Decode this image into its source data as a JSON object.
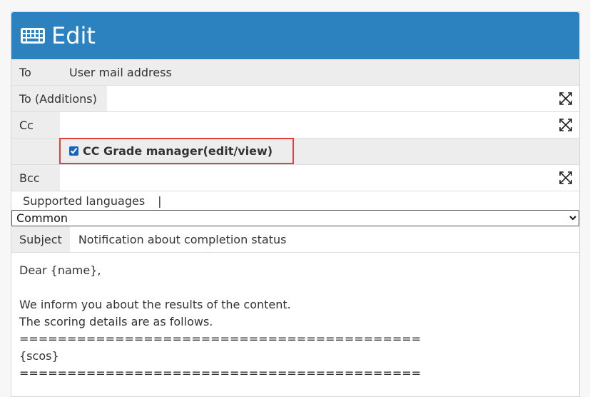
{
  "header": {
    "title": "Edit",
    "icon": "keyboard-icon",
    "color": "#2b82be"
  },
  "fields": {
    "to": {
      "label": "To",
      "value": "User mail address"
    },
    "to_additions": {
      "label": "To (Additions)",
      "value": ""
    },
    "cc": {
      "label": "Cc",
      "value": ""
    },
    "cc_grade_manager": {
      "label": "CC Grade manager(edit/view)",
      "checked": true
    },
    "bcc": {
      "label": "Bcc",
      "value": ""
    }
  },
  "languages": {
    "label": "Supported languages",
    "separator": "|",
    "selected": "Common"
  },
  "subject": {
    "label": "Subject",
    "value": "Notification about completion status"
  },
  "body": {
    "text": "Dear {name},\n\nWe inform you about the results of the content.\nThe scoring details are as follows.\n==========================================\n{scos}\n=========================================="
  },
  "icons": {
    "expand": "expand-icon"
  },
  "highlight_color": "#e0403b"
}
